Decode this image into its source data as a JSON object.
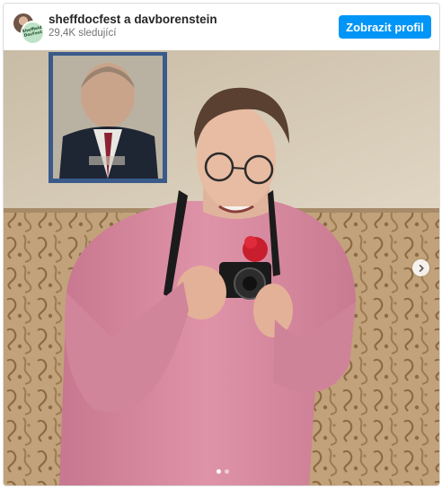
{
  "post": {
    "account_primary": "sheffdocfest",
    "account_joiner": "a",
    "account_secondary": "davborenstein",
    "followers": "29,4K sledující",
    "profile_button": "Zobrazit profil",
    "avatar_logo_text": "Sheffield DocFest"
  },
  "carousel": {
    "total_slides": 2,
    "active_slide": 1
  },
  "icons": {
    "next": "chevron-right-icon"
  },
  "colors": {
    "button": "#0095f6",
    "sweater": "#d98aa0",
    "wall_upper": "#d9cdb8",
    "wallpaper": "#b89366"
  }
}
